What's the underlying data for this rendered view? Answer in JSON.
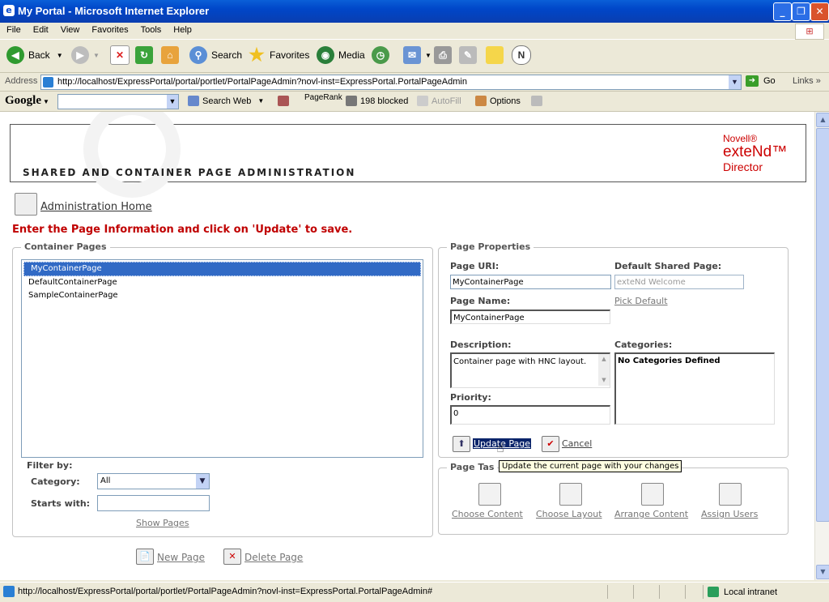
{
  "window": {
    "title": "My Portal - Microsoft Internet Explorer",
    "controls": [
      "_",
      "❐",
      "✕"
    ]
  },
  "menu": [
    "File",
    "Edit",
    "View",
    "Favorites",
    "Tools",
    "Help"
  ],
  "toolbar": {
    "back": "Back",
    "search": "Search",
    "favorites": "Favorites",
    "media": "Media"
  },
  "address": {
    "label": "Address",
    "url": "http://localhost/ExpressPortal/portal/portlet/PortalPageAdmin?novl-inst=ExpressPortal.PortalPageAdmin",
    "go": "Go",
    "links": "Links"
  },
  "googlebar": {
    "logo": "Google",
    "search_web": "Search Web",
    "pagerank": "PageRank",
    "blocked": "198 blocked",
    "autofill": "AutoFill",
    "options": "Options"
  },
  "banner": {
    "heading": "SHARED AND CONTAINER PAGE ADMINISTRATION",
    "brand_line1": "Novell®",
    "brand_line2": "exteNd™",
    "brand_line3": "Director"
  },
  "admin_home": "Administration Home",
  "instruction": "Enter the Page Information and click on 'Update' to save.",
  "container_pages": {
    "legend": "Container Pages",
    "items": [
      "MyContainerPage",
      "DefaultContainerPage",
      "SampleContainerPage"
    ],
    "selected_index": 0
  },
  "filter": {
    "label": "Filter by:",
    "category_label": "Category:",
    "category_value": "All",
    "starts_with_label": "Starts with:",
    "starts_with_value": "",
    "show_pages": "Show Pages"
  },
  "page_actions": {
    "new_page": "New Page",
    "delete_page": "Delete Page"
  },
  "page_properties": {
    "legend": "Page Properties",
    "uri_label": "Page URI:",
    "uri_value": "MyContainerPage",
    "default_shared_label": "Default Shared Page:",
    "default_shared_value": "exteNd Welcome",
    "pick_default": "Pick Default",
    "name_label": "Page Name:",
    "name_value": "MyContainerPage",
    "description_label": "Description:",
    "description_value": "Container page with HNC layout.",
    "categories_label": "Categories:",
    "categories_value": "No Categories Defined",
    "priority_label": "Priority:",
    "priority_value": "0",
    "update_button": "Update Page",
    "cancel_button": "Cancel"
  },
  "tooltip": "Update the current page with your changes",
  "page_tasks": {
    "legend": "Page Tasks",
    "legend_visible": "Page Tas",
    "items": [
      "Choose Content",
      "Choose Layout",
      "Arrange Content",
      "Assign Users"
    ]
  },
  "status": {
    "url": "http://localhost/ExpressPortal/portal/portlet/PortalPageAdmin?novl-inst=ExpressPortal.PortalPageAdmin#",
    "zone": "Local intranet"
  },
  "colors": {
    "title_bar": "#0a4cd0",
    "instruction_red": "#c00000",
    "selection_blue": "#316ac5",
    "tooltip_bg": "#ffffe1"
  }
}
